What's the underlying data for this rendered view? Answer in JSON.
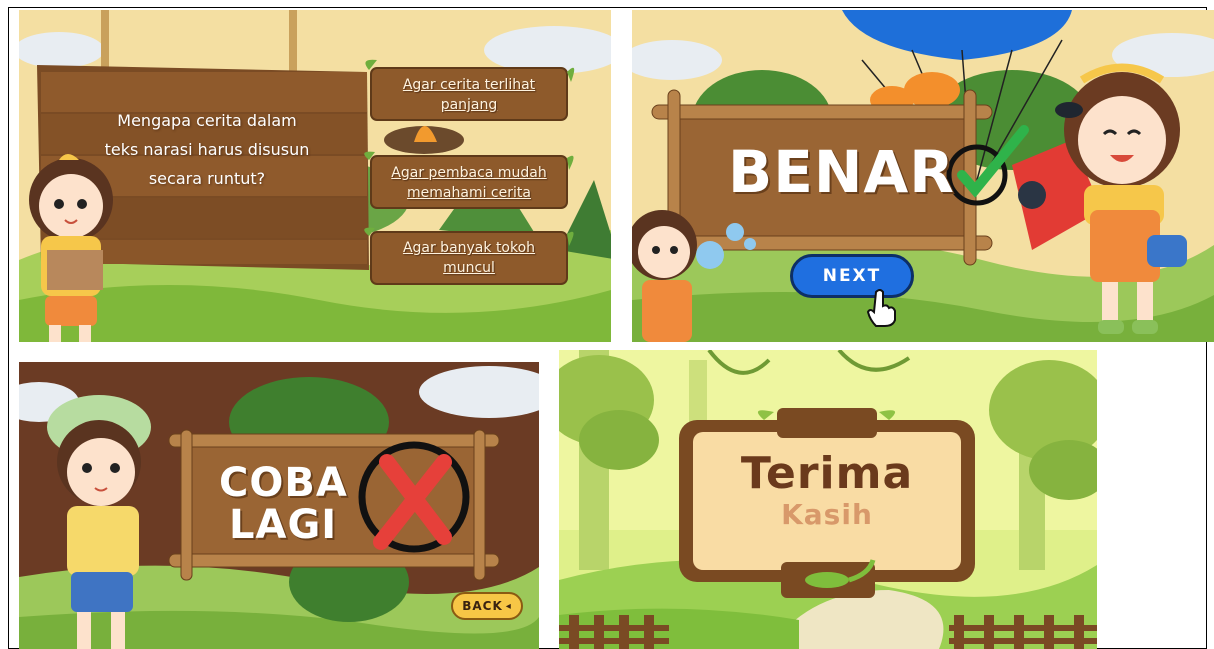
{
  "quiz": {
    "question": "Mengapa cerita dalam teks narasi harus disusun secara runtut?",
    "options": [
      {
        "label": "Agar cerita terlihat panjang"
      },
      {
        "label": "Agar pembaca mudah memahami cerita"
      },
      {
        "label": "Agar banyak tokoh muncul"
      }
    ]
  },
  "correct": {
    "title": "BENAR",
    "next_label": "NEXT"
  },
  "wrong": {
    "title_line1": "COBA",
    "title_line2": "LAGI",
    "back_label": "BACK"
  },
  "ending": {
    "title": "Terima",
    "subtitle": "Kasih"
  },
  "colors": {
    "sky": "#f6e3a8",
    "wood": "#8b5a2b",
    "grass": "#8cc63f",
    "next_btn": "#1f6fe0",
    "back_btn": "#f7c646",
    "cross": "#e6403a",
    "check": "#2fb34a"
  }
}
